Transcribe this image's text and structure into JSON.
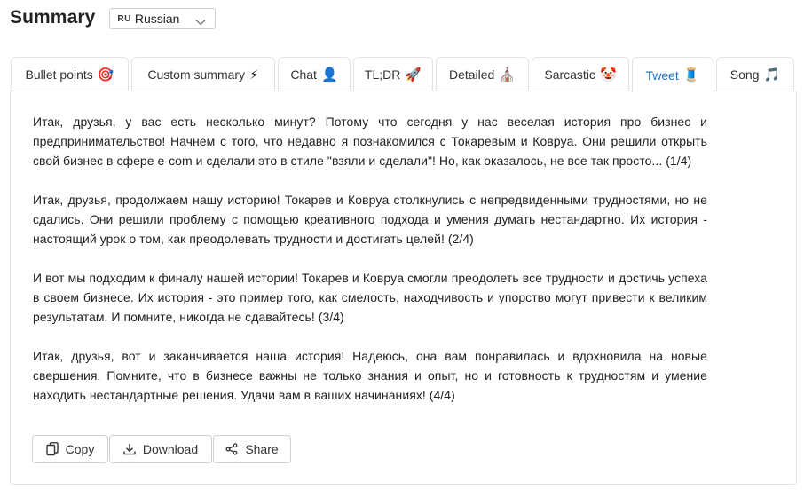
{
  "header": {
    "title": "Summary",
    "language": {
      "code": "RU",
      "label": "Russian"
    }
  },
  "tabs": [
    {
      "label": "Bullet points",
      "emoji": "🎯",
      "icon": "target-icon",
      "active": false
    },
    {
      "label": "Custom summary",
      "emoji": "⚡",
      "icon": "lightning-icon",
      "active": false
    },
    {
      "label": "Chat",
      "emoji": "👤",
      "icon": "person-icon",
      "active": false
    },
    {
      "label": "TL;DR",
      "emoji": "🚀",
      "icon": "rocket-icon",
      "active": false
    },
    {
      "label": "Detailed",
      "emoji": "⛪",
      "icon": "building-icon",
      "active": false
    },
    {
      "label": "Sarcastic",
      "emoji": "🤡",
      "icon": "clown-icon",
      "active": false
    },
    {
      "label": "Tweet",
      "emoji": "🧵",
      "icon": "thread-icon",
      "active": true
    },
    {
      "label": "Song",
      "emoji": "🎵",
      "icon": "music-note-icon",
      "active": false
    }
  ],
  "content": {
    "paragraphs": [
      "Итак, друзья, у вас есть несколько минут? Потому что сегодня у нас веселая история про бизнес и предпринимательство! Начнем с того, что недавно я познакомился с Токаревым и Коврyа. Они решили открыть свой бизнес в сфере e-com и сделали это в стиле \"взяли и сделали\"! Но, как оказалось, не все так просто... (1/4)",
      "Итак, друзья, продолжаем нашу историю! Токарев и Коврyа столкнулись с непредвиденными трудностями, но не сдались. Они решили проблему с помощью креативного подхода и умения думать нестандартно. Их история - настоящий урок о том, как преодолевать трудности и достигать целей! (2/4)",
      "И вот мы подходим к финалу нашей истории! Токарев и Коврyа смогли преодолеть все трудности и достичь успеха в своем бизнесе. Их история - это пример того, как смелость, находчивость и упорство могут привести к великим результатам. И помните, никогда не сдавайтесь! (3/4)",
      "Итак, друзья, вот и заканчивается наша история! Надеюсь, она вам понравилась и вдохновила на новые свершения. Помните, что в бизнесе важны не только знания и опыт, но и готовность к трудностям и умение находить нестандартные решения. Удачи вам в ваших начинаниях! (4/4)"
    ]
  },
  "actions": {
    "copy": "Copy",
    "download": "Download",
    "share": "Share"
  },
  "colors": {
    "active_tab": "#1a73c8",
    "border": "#e3e3e3"
  }
}
